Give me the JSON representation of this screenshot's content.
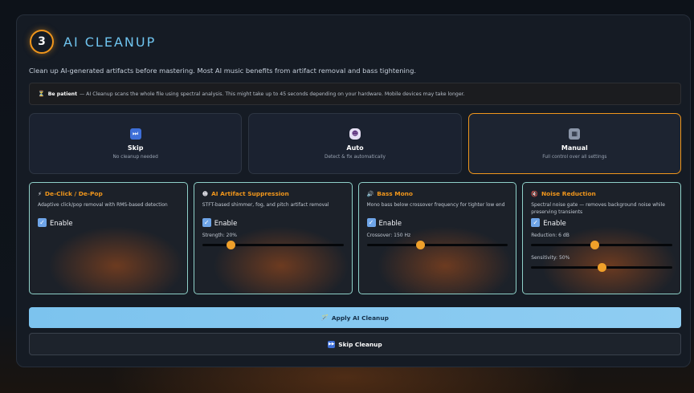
{
  "step": {
    "number": "3",
    "title": "AI CLEANUP"
  },
  "intro": "Clean up AI-generated artifacts before mastering. Most AI music benefits from artifact removal and bass tightening.",
  "notice": {
    "icon": "hourglass-icon",
    "bold": "Be patient",
    "text": "— AI Cleanup scans the whole file using spectral analysis. This might take up to 45 seconds depending on your hardware. Mobile devices may take longer."
  },
  "modes": [
    {
      "icon": "fast-forward-icon",
      "glyph": "⏭",
      "title": "Skip",
      "subtitle": "No cleanup needed",
      "active": false
    },
    {
      "icon": "robot-icon",
      "glyph": "☻",
      "title": "Auto",
      "subtitle": "Detect & fix automatically",
      "active": false
    },
    {
      "icon": "control-knobs-icon",
      "glyph": "▦",
      "title": "Manual",
      "subtitle": "Full control over all settings",
      "active": true
    }
  ],
  "cards": [
    {
      "icon": "lightning-icon",
      "glyph": "⚡",
      "title": "De-Click / De-Pop",
      "desc": "Adaptive click/pop removal with RMS-based detection",
      "enable_label": "Enable",
      "enabled": true,
      "sliders": []
    },
    {
      "icon": "robot-icon",
      "glyph": "☻",
      "title": "AI Artifact Suppression",
      "desc": "STFT-based shimmer, fog, and pitch artifact removal",
      "enable_label": "Enable",
      "enabled": true,
      "sliders": [
        {
          "label": "Strength: 20%",
          "value": 0.2
        }
      ]
    },
    {
      "icon": "speaker-icon",
      "glyph": "🔊",
      "title": "Bass Mono",
      "desc": "Mono bass below crossover frequency for tighter low end",
      "enable_label": "Enable",
      "enabled": true,
      "sliders": [
        {
          "label": "Crossover: 150 Hz",
          "value": 0.38
        }
      ]
    },
    {
      "icon": "mute-speaker-icon",
      "glyph": "🔇",
      "title": "Noise Reduction",
      "desc": "Spectral noise gate — removes background noise while preserving transients",
      "enable_label": "Enable",
      "enabled": true,
      "sliders": [
        {
          "label": "Reduction: 6 dB",
          "value": 0.45
        },
        {
          "label": "Sensitivity: 50%",
          "value": 0.5
        }
      ]
    }
  ],
  "apply_button": {
    "icon": "magic-wand-icon",
    "glyph": "🪄",
    "label": "Apply AI Cleanup"
  },
  "skip_button": {
    "icon": "fast-forward-icon",
    "glyph": "⏭",
    "label": "Skip Cleanup"
  },
  "colors": {
    "accent": "#f0961c",
    "title": "#6fc4ef",
    "apply": "#7cc3ee",
    "card_border": "#8fd1c9"
  }
}
